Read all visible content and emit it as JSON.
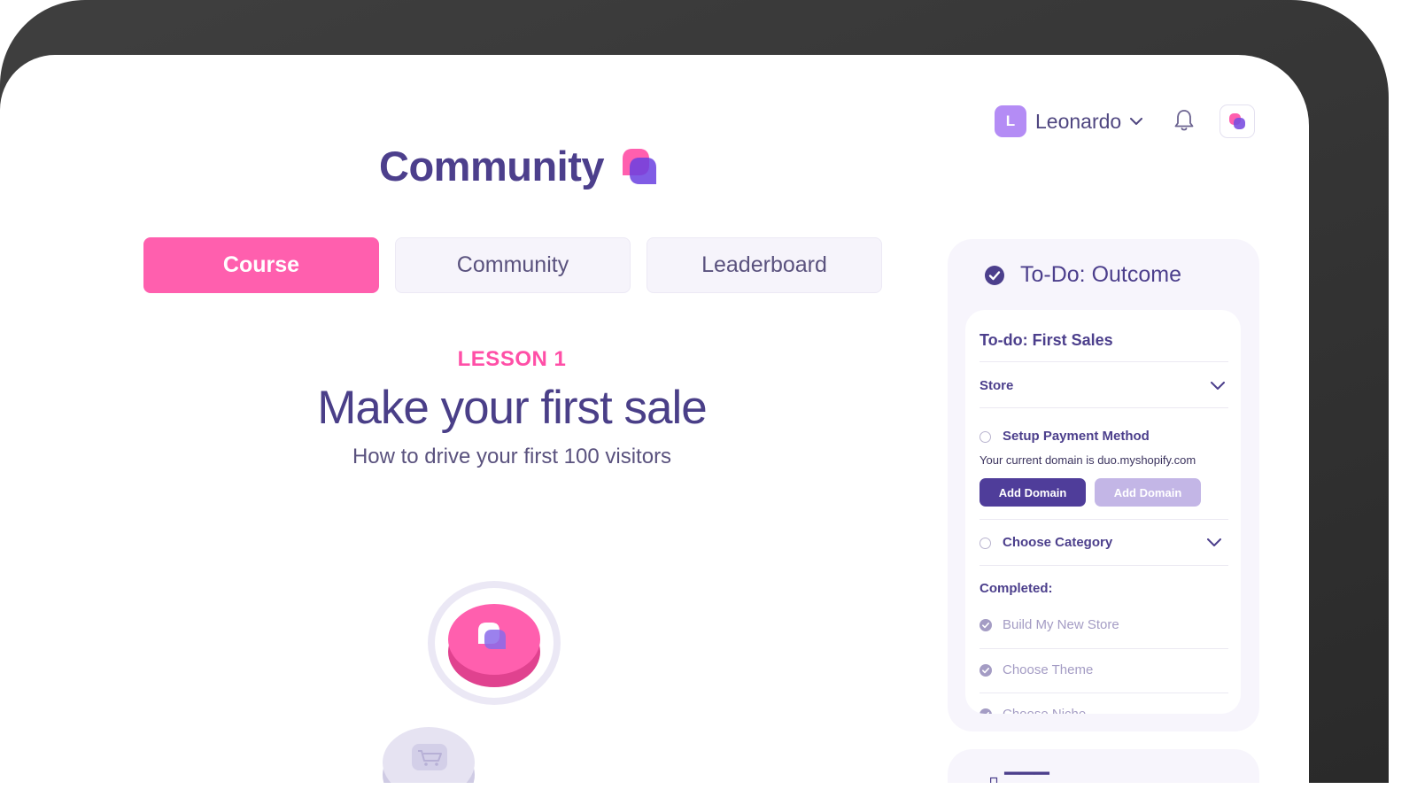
{
  "header": {
    "user": {
      "initial": "L",
      "name": "Leonardo"
    },
    "icons": [
      "chevron-down-icon",
      "bell-icon",
      "app-logo-icon"
    ]
  },
  "page": {
    "title": "Community"
  },
  "tabs": [
    {
      "label": "Course",
      "active": true
    },
    {
      "label": "Community",
      "active": false
    },
    {
      "label": "Leaderboard",
      "active": false
    }
  ],
  "lesson": {
    "label": "LESSON 1",
    "title": "Make your first sale",
    "subtitle": "How to drive your first 100 visitors"
  },
  "todo": {
    "title": "To-Do: Outcome",
    "card_title": "To-do: First Sales",
    "section": "Store",
    "task_payment": "Setup Payment Method",
    "domain_text": "Your current domain is duo.myshopify.com",
    "btn_primary": "Add Domain",
    "btn_muted": "Add Domain",
    "task_category": "Choose Category",
    "completed_label": "Completed:",
    "completed": [
      "Build My New Store",
      "Choose Theme",
      "Choose Niche"
    ]
  },
  "colors": {
    "accent_pink": "#ff5fae",
    "brand_purple": "#4c3f8c",
    "button_primary": "#4f3d9a",
    "button_muted": "#c3b6e6"
  }
}
